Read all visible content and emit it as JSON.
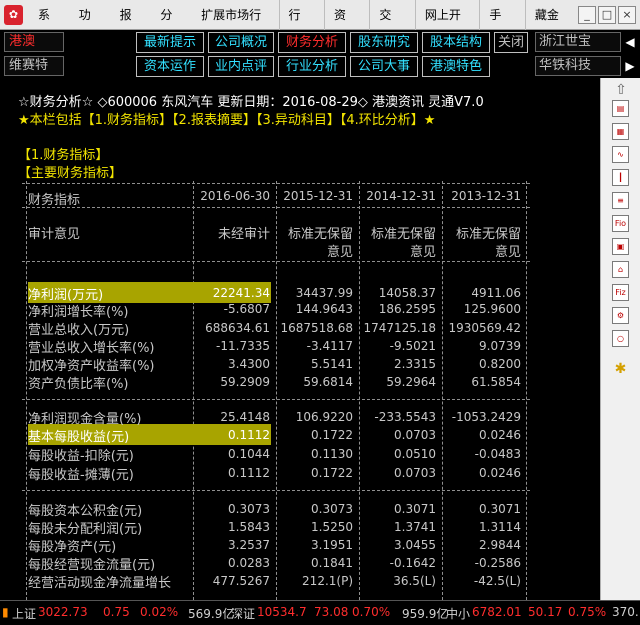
{
  "menubar": {
    "logo": "✿",
    "items": [
      "系统",
      "功能",
      "报价",
      "分析",
      "扩展市场行情",
      "行 情",
      "资 讯",
      "交 易",
      "网上开户",
      "手 机",
      "藏金阁"
    ],
    "win_min": "_",
    "win_max": "□",
    "win_close": "×"
  },
  "nav": {
    "stock_current": "港澳",
    "stock_alt": "维赛特",
    "tabs_row1": [
      "最新提示",
      "公司概况",
      "财务分析",
      "股东研究",
      "股本结构",
      "关闭"
    ],
    "tabs_row2": [
      "资本运作",
      "业内点评",
      "行业分析",
      "公司大事",
      "港澳特色"
    ],
    "active_tab": "财务分析",
    "right_top": "浙江世宝",
    "right_bottom": "华铁科技",
    "arrow_left": "◀",
    "arrow_right": "▶",
    "colors": {
      "tab_text": "#33e0ff",
      "active_tab": "#ff2d2d"
    }
  },
  "content": {
    "header_line1": "☆财务分析☆ ◇600006 东风汽车 更新日期：2016-08-29◇ 港澳资讯 灵通V7.0",
    "header_line2": "★本栏包括【1.财务指标】【2.报表摘要】【3.异动科目】【4.环比分析】★",
    "section": "【1.财务指标】",
    "subsection": "【主要财务指标】",
    "table": {
      "header_label": "财务指标",
      "columns": [
        "2016-06-30",
        "2015-12-31",
        "2014-12-31",
        "2013-12-31"
      ],
      "audit_label": "审计意见",
      "audit": [
        "未经审计",
        "标准无保留",
        "标准无保留",
        "标准无保留"
      ],
      "audit_line2": [
        "",
        "意见",
        "意见",
        "意见"
      ],
      "group1": [
        {
          "label": "净利润(万元)",
          "values": [
            "22241.34",
            "34437.99",
            "14058.37",
            "4911.06"
          ]
        },
        {
          "label": "净利润增长率(%)",
          "values": [
            "-5.6807",
            "144.9643",
            "186.2595",
            "125.9600"
          ]
        },
        {
          "label": "营业总收入(万元)",
          "values": [
            "688634.61",
            "1687518.68",
            "1747125.18",
            "1930569.42"
          ]
        },
        {
          "label": "营业总收入增长率(%)",
          "values": [
            "-11.7335",
            "-3.4117",
            "-9.5021",
            "9.0739"
          ]
        },
        {
          "label": "加权净资产收益率(%)",
          "values": [
            "3.4300",
            "5.5141",
            "2.3315",
            "0.8200"
          ]
        },
        {
          "label": "资产负债比率(%)",
          "values": [
            "59.2909",
            "59.6814",
            "59.2964",
            "61.5854"
          ]
        }
      ],
      "group2": [
        {
          "label": "净利润现金含量(%)",
          "values": [
            "25.4148",
            "106.9220",
            "-233.5543",
            "-1053.2429"
          ]
        },
        {
          "label": "基本每股收益(元)",
          "values": [
            "0.1112",
            "0.1722",
            "0.0703",
            "0.0246"
          ]
        },
        {
          "label": "每股收益-扣除(元)",
          "values": [
            "0.1044",
            "0.1130",
            "0.0510",
            "-0.0483"
          ]
        },
        {
          "label": "每股收益-摊薄(元)",
          "values": [
            "0.1112",
            "0.1722",
            "0.0703",
            "0.0246"
          ]
        }
      ],
      "group3": [
        {
          "label": "每股资本公积金(元)",
          "values": [
            "0.3073",
            "0.3073",
            "0.3071",
            "0.3071"
          ]
        },
        {
          "label": "每股未分配利润(元)",
          "values": [
            "1.5843",
            "1.5250",
            "1.3741",
            "1.3114"
          ]
        },
        {
          "label": "每股净资产(元)",
          "values": [
            "3.2537",
            "3.1951",
            "3.0455",
            "2.9844"
          ]
        },
        {
          "label": "每股经营现金流量(元)",
          "values": [
            "0.0283",
            "0.1841",
            "-0.1642",
            "-0.2586"
          ]
        },
        {
          "label": "经营活动现金净流量增长",
          "values": [
            "477.5267",
            "212.1(P)",
            "36.5(L)",
            "-42.5(L)"
          ]
        }
      ],
      "highlight_color": "#a8a400"
    }
  },
  "toolbar": {
    "icons": [
      "arrow-up-icon",
      "arrow-down-icon",
      "report-icon",
      "grid-icon",
      "line-chart-icon",
      "candle-icon",
      "list-icon",
      "fio-icon",
      "f10-icon",
      "home-icon",
      "fiz-icon",
      "settings-icon",
      "circle-icon",
      "gear-icon"
    ],
    "labels": [
      "",
      "",
      "",
      "",
      "",
      "",
      "",
      "Fio",
      "",
      "",
      "Fiz",
      "",
      "",
      ""
    ]
  },
  "statusbar": {
    "sh_label": "上证",
    "sh_value": "3022.73",
    "sh_change": "0.75",
    "sh_pct": "0.02%",
    "sh_vol": "569.9亿",
    "sz_label": "深证",
    "sz_value": "10534.7",
    "sz_change": "73.08",
    "sz_pct": "0.70%",
    "sz_vol": "959.9亿",
    "zx_label": "中小",
    "zx_value": "6782.01",
    "zx_change": "50.17",
    "zx_pct": "0.75%",
    "zx_vol": "370."
  }
}
